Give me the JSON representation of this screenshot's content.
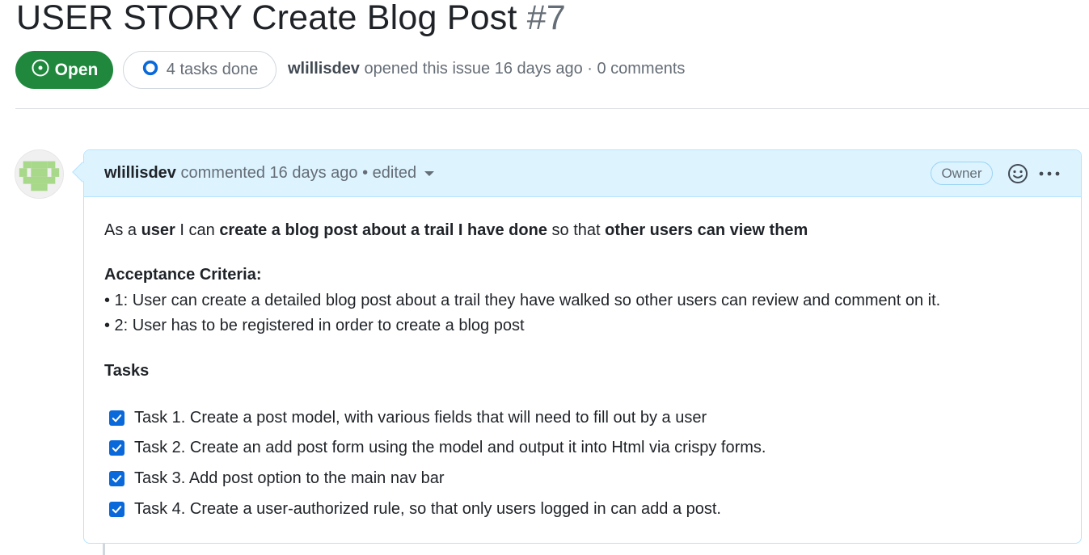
{
  "issue": {
    "title": "USER STORY Create Blog Post",
    "number": "#7",
    "state": "Open",
    "tasks_done": "4 tasks done",
    "author": "wlillisdev",
    "meta_rest": "opened this issue 16 days ago · 0 comments"
  },
  "comment": {
    "author": "wlillisdev",
    "meta": "commented 16 days ago",
    "edited": "• edited",
    "role_badge": "Owner",
    "story": {
      "p1": "As a ",
      "b1": "user",
      "p2": " I can ",
      "b2": "create a blog post about a trail I have done",
      "p3": " so that ",
      "b3": "other users can view them"
    },
    "acceptance_heading": "Acceptance Criteria:",
    "criteria": [
      "• 1: User can create a detailed blog post about a trail they have walked so other users can review and comment on it.",
      "• 2: User has to be registered in order to create a blog post"
    ],
    "tasks_heading": "Tasks",
    "tasks": [
      {
        "label": "Task 1. Create a post model, with various fields that will need to fill out by a user",
        "checked": true
      },
      {
        "label": "Task 2. Create an add post form using the model and output it into Html via crispy forms.",
        "checked": true
      },
      {
        "label": "Task 3. Add post option to the main nav bar",
        "checked": true
      },
      {
        "label": "Task 4. Create a user-authorized rule, so that only users logged in can add a post.",
        "checked": true
      }
    ]
  },
  "icons": {
    "state": "issue-opened-icon",
    "tasks": "progress-circle-icon",
    "reaction": "smiley-icon",
    "menu": "kebab-horizontal-icon",
    "checkbox": "checkbox-checked-icon"
  },
  "colors": {
    "open_green": "#1f883d",
    "comment_header_bg": "#ddf4ff",
    "comment_border": "#b6e3ff",
    "checkbox_blue": "#0969da",
    "muted_text": "#656d76"
  }
}
